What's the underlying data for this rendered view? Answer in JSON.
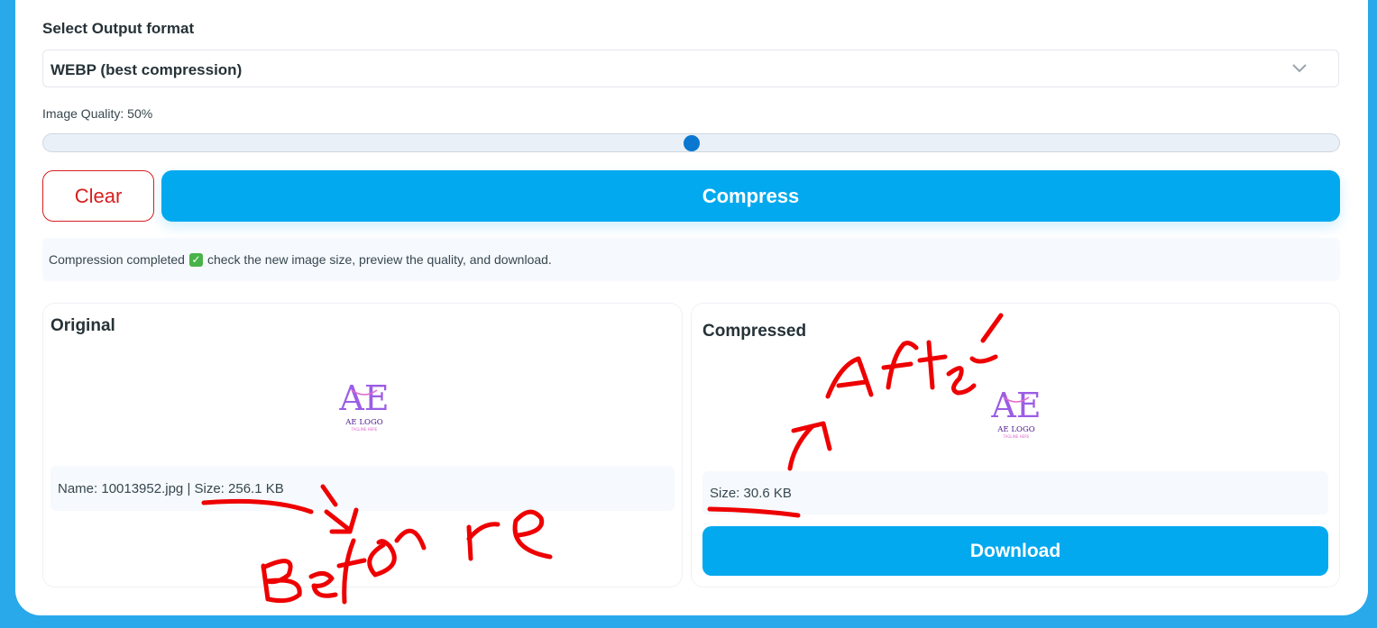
{
  "format": {
    "label": "Select Output format",
    "selected": "WEBP (best compression)"
  },
  "quality": {
    "label": "Image Quality: 50%",
    "value": 50
  },
  "buttons": {
    "clear": "Clear",
    "compress": "Compress",
    "download": "Download"
  },
  "status": {
    "before_icon": "Compression completed",
    "after_icon": "check the new image size, preview the quality, and download."
  },
  "original": {
    "title": "Original",
    "info": "Name: 10013952.jpg | Size: 256.1 KB",
    "logo": {
      "mark": "AE",
      "wordmark": "AE LOGO",
      "tagline": "TAGLINE HERE"
    }
  },
  "compressed": {
    "title": "Compressed",
    "info": "Size: 30.6 KB",
    "logo": {
      "mark": "AE",
      "wordmark": "AE LOGO",
      "tagline": "TAGLINE HERE"
    }
  },
  "annotations": {
    "before": "Before",
    "after": "After"
  },
  "colors": {
    "accent": "#03a9ef",
    "danger": "#d81e1e",
    "ink": "#ee0000",
    "background": "#29a9ea",
    "slider_thumb": "#0a77d0",
    "logo_purple": "#9b5de5",
    "logo_pink": "#e06acb"
  },
  "icons": {
    "select_arrow": "chevron-down-icon",
    "status_check": "check-mark-icon"
  }
}
